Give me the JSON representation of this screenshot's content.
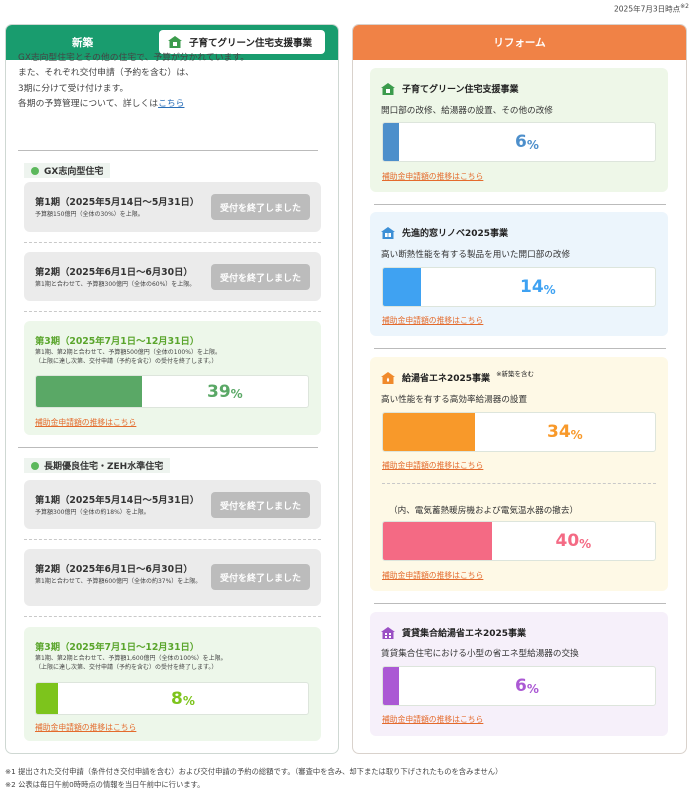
{
  "timestamp": {
    "text": "2025年7月3日時点",
    "sup": "※2"
  },
  "left": {
    "header": "新築",
    "tag": "子育てグリーン住宅支援事業",
    "intro": {
      "line1": "GX志向型住宅とその他の住宅で、予算が分かれています。",
      "line2": "また、それぞれ交付申請（予約を含む）は、",
      "line3": "3期に分けて受け付けます。",
      "line4_prefix": "各期の予算管理について、詳しくは",
      "line4_link": "こちら"
    },
    "sections": [
      {
        "label": "GX志向型住宅",
        "periods": [
          {
            "title": "第1期（2025年5月14日〜5月31日）",
            "note": "予算額150億円（全体の30%）を上限。",
            "button": "受付を終了しました"
          },
          {
            "title": "第2期（2025年6月1日〜6月30日）",
            "note": "第1期と合わせて、予算額300億円（全体の60%）を上限。",
            "button": "受付を終了しました"
          },
          {
            "title": "第3期（2025年7月1日〜12月31日）",
            "note1": "第1期、第2期と合わせて、予算額500億円（全体の100%）を上限。",
            "note2": "（上限に達し次第、交付申請（予約を含む）の受付を終了します。）",
            "percent": 39,
            "percent_text": "39",
            "unit": "%",
            "bar_color": "#5aa866",
            "text_color": "#5aa866",
            "link": "補助金申請額の推移はこちら"
          }
        ]
      },
      {
        "label": "長期優良住宅・ZEH水準住宅",
        "periods": [
          {
            "title": "第1期（2025年5月14日〜5月31日）",
            "note": "予算額300億円（全体の約18%）を上限。",
            "button": "受付を終了しました"
          },
          {
            "title": "第2期（2025年6月1日〜6月30日）",
            "note": "第1期と合わせて、予算額600億円（全体の約37%）を上限。",
            "button": "受付を終了しました"
          },
          {
            "title": "第3期（2025年7月1日〜12月31日）",
            "note1": "第1期、第2期と合わせて、予算額1,600億円（全体の100%）を上限。",
            "note2": "（上限に達し次第、交付申請（予約を含む）の受付を終了します。）",
            "percent": 8,
            "percent_text": "8",
            "unit": "%",
            "bar_color": "#7dc41c",
            "text_color": "#7dc41c",
            "link": "補助金申請額の推移はこちら"
          }
        ]
      }
    ]
  },
  "right": {
    "header": "リフォーム",
    "cards": [
      {
        "title": "子育てグリーン住宅支援事業",
        "icon_color": "#3b9b4c",
        "desc": "開口部の改修、給湯器の設置、その他の改修",
        "percent": 6,
        "percent_text": "6",
        "unit": "%",
        "bar_color": "#4d8fcb",
        "text_color": "#4d8fcb",
        "link": "補助金申請額の推移はこちら"
      },
      {
        "title": "先進的窓リノベ2025事業",
        "icon_color": "#3c8fd6",
        "desc": "高い断熱性能を有する製品を用いた開口部の改修",
        "percent": 14,
        "percent_text": "14",
        "unit": "%",
        "bar_color": "#3fa2f2",
        "text_color": "#3fa2f2",
        "link": "補助金申請額の推移はこちら"
      },
      {
        "title": "給湯省エネ2025事業",
        "note": "※新築を含む",
        "icon_color": "#f08a2c",
        "desc": "高い性能を有する高効率給湯器の設置",
        "percent": 34,
        "percent_text": "34",
        "unit": "%",
        "bar_color": "#f8992a",
        "text_color": "#f8992a",
        "link": "補助金申請額の推移はこちら",
        "sub": {
          "desc": "（内、電気蓄熱暖房機および電気温水器の撤去）",
          "percent": 40,
          "percent_text": "40",
          "unit": "%",
          "bar_color": "#f46a84",
          "text_color": "#f46a84",
          "link": "補助金申請額の推移はこちら"
        }
      },
      {
        "title": "賃貸集合給湯省エネ2025事業",
        "icon_color": "#9a4fc4",
        "desc": "賃貸集合住宅における小型の省エネ型給湯器の交換",
        "percent": 6,
        "percent_text": "6",
        "unit": "%",
        "bar_color": "#ab59d4",
        "text_color": "#ab59d4",
        "link": "補助金申請額の推移はこちら"
      }
    ]
  },
  "footnotes": {
    "note1": "※1 提出された交付申請（条件付き交付申請を含む）および交付申請の予約の総額です。（審査中を含み、却下または取り下げされたものを含みません）",
    "note2": "※2 公表は毎日午前0時時点の情報を当日午前中に行います。"
  }
}
